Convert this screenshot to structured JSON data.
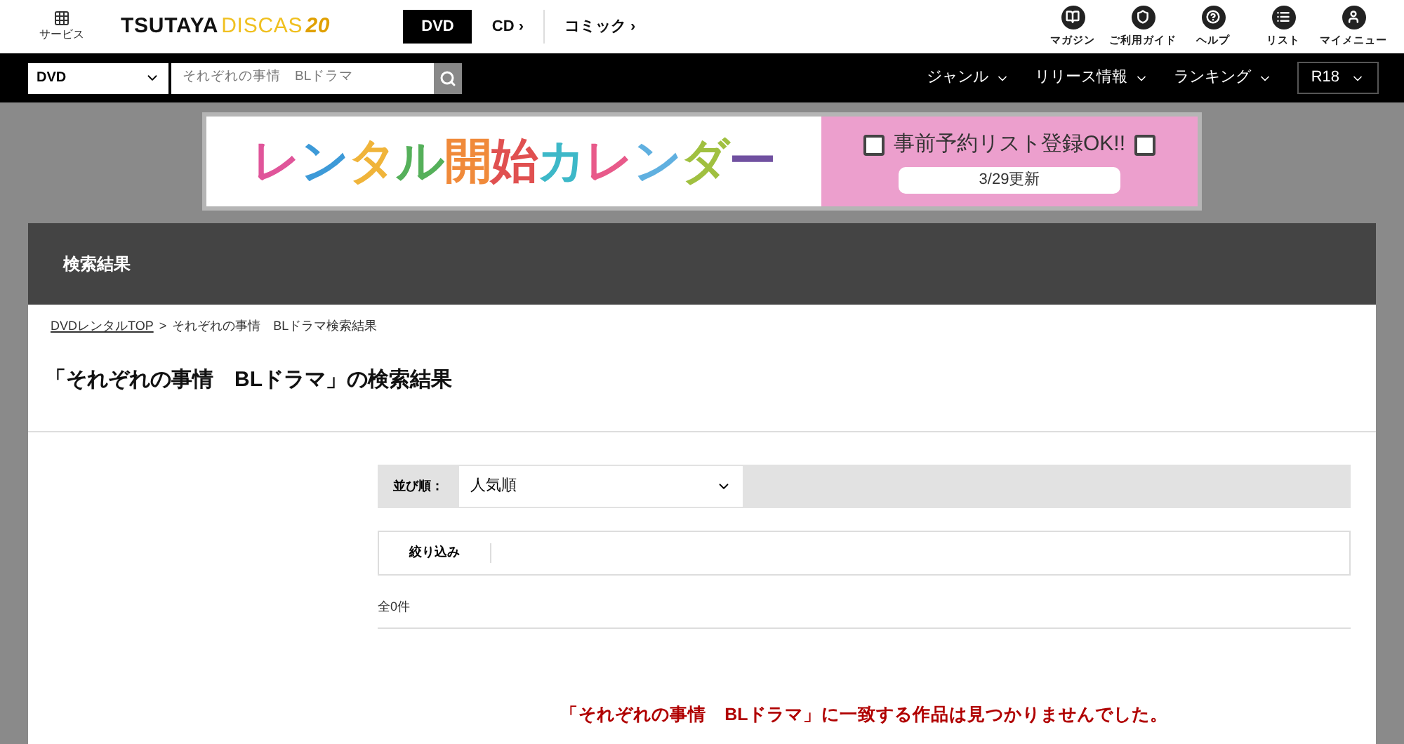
{
  "header": {
    "service_label": "サービス",
    "logo": {
      "part_1": "TSUTAYA",
      "part_2": "DISCAS",
      "badge": "20"
    },
    "categories": [
      {
        "label": "DVD",
        "selected": true
      },
      {
        "label": "CD",
        "selected": false,
        "arrow": "›"
      },
      {
        "label": "コミック",
        "selected": false,
        "arrow": "›"
      }
    ],
    "links": [
      {
        "kind": "magazine",
        "label": "マガジン"
      },
      {
        "kind": "guide",
        "label": "ご利用ガイド"
      },
      {
        "kind": "help",
        "label": "ヘルプ"
      },
      {
        "kind": "list",
        "label": "リスト"
      },
      {
        "kind": "user",
        "label": "マイメニュー"
      }
    ]
  },
  "search_bar": {
    "category": "DVD",
    "query": "それぞれの事情　BLドラマ",
    "menus": [
      "ジャンル",
      "リリース情報",
      "ランキング"
    ],
    "rating": "R18"
  },
  "banner": {
    "title": "レンタル開始カレンダー",
    "subtitle": "事前予約リスト登録OK!!",
    "update": "3/29更新"
  },
  "section_title": "検索結果",
  "breadcrumb": {
    "link": "DVDレンタルTOP",
    "separator": ">",
    "current": "それぞれの事情　BLドラマ検索結果"
  },
  "heading": "「それぞれの事情　BLドラマ」の検索結果",
  "sort": {
    "label": "並び順：",
    "value": "人気順"
  },
  "filter_label": "絞り込み",
  "count": "全0件",
  "empty_message": "「それぞれの事情　BLドラマ」に一致する作品は見つかりませんでした。"
}
